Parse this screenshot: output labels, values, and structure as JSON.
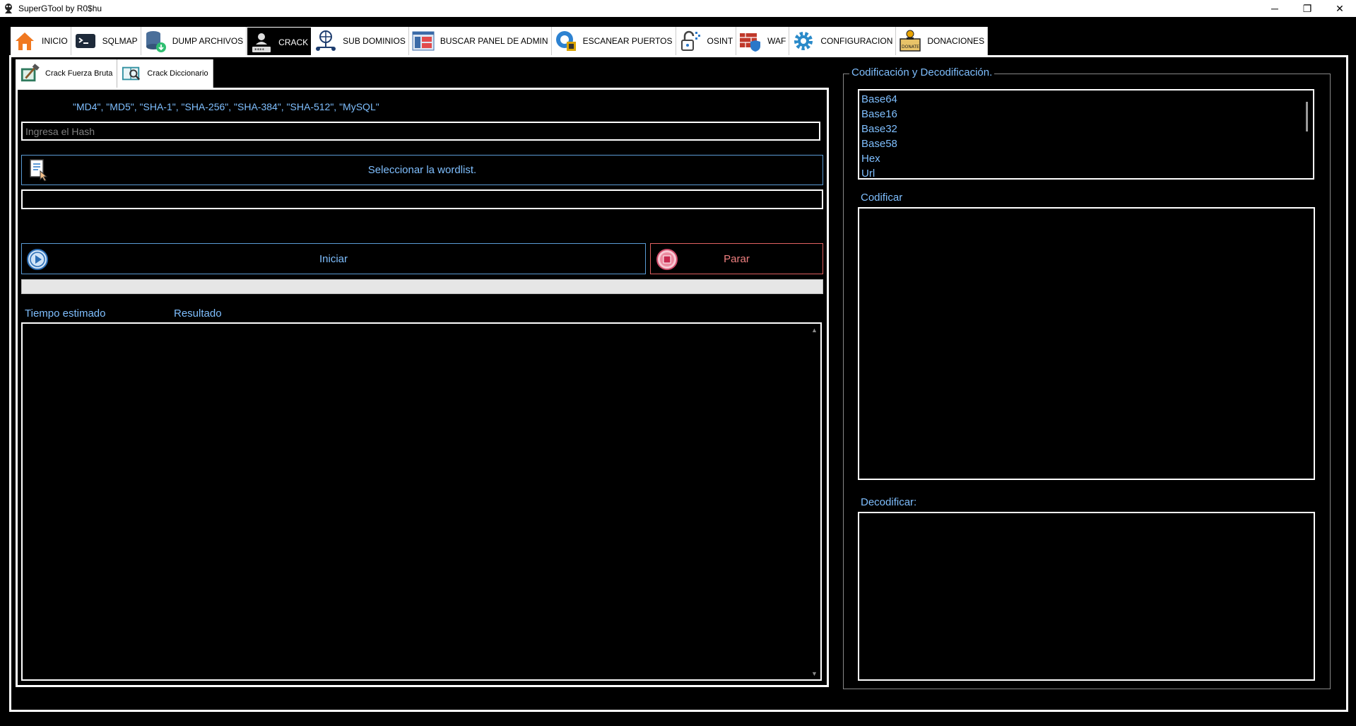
{
  "window": {
    "title": "SuperGTool by R0$hu",
    "controls": {
      "minimize": "─",
      "restore": "❐",
      "close": "✕"
    }
  },
  "main_tabs": [
    {
      "label": "INICIO",
      "icon": "home-icon"
    },
    {
      "label": "SQLMAP",
      "icon": "terminal-icon"
    },
    {
      "label": "DUMP ARCHIVOS",
      "icon": "database-download-icon"
    },
    {
      "label": "CRACK",
      "icon": "hacker-password-icon"
    },
    {
      "label": "SUB DOMINIOS",
      "icon": "globe-network-icon"
    },
    {
      "label": "BUSCAR PANEL DE ADMIN",
      "icon": "admin-panel-icon"
    },
    {
      "label": "ESCANEAR PUERTOS",
      "icon": "port-scan-icon"
    },
    {
      "label": "OSINT",
      "icon": "unlock-icon"
    },
    {
      "label": "WAF",
      "icon": "firewall-icon"
    },
    {
      "label": "CONFIGURACION",
      "icon": "gear-icon"
    },
    {
      "label": "DONACIONES",
      "icon": "donate-icon"
    }
  ],
  "active_main_tab": "CRACK",
  "sub_tabs": [
    {
      "label": "Crack Fuerza Bruta",
      "icon": "hammer-icon"
    },
    {
      "label": "Crack Diccionario",
      "icon": "dictionary-icon"
    }
  ],
  "active_sub_tab": "Crack Diccionario",
  "crack": {
    "hash_types": "\"MD4\", \"MD5\", \"SHA-1\", \"SHA-256\", \"SHA-384\", \"SHA-512\", \"MySQL\"",
    "hash_placeholder": "Ingresa el Hash",
    "hash_value": "",
    "wordlist_button": "Seleccionar la wordlist.",
    "wordlist_path": "",
    "start_button": "Iniciar",
    "stop_button": "Parar",
    "progress": 0,
    "col_time": "Tiempo estimado",
    "col_result": "Resultado"
  },
  "codec": {
    "title": "Codificación y Decodificación.",
    "methods": [
      "Base64",
      "Base16",
      "Base32",
      "Base58",
      "Hex",
      "Url"
    ],
    "encode_label": "Codificar",
    "decode_label": "Decodificar:"
  },
  "colors": {
    "accent_text": "#7fbfff",
    "stop_red": "#f08080",
    "background": "#000000"
  }
}
